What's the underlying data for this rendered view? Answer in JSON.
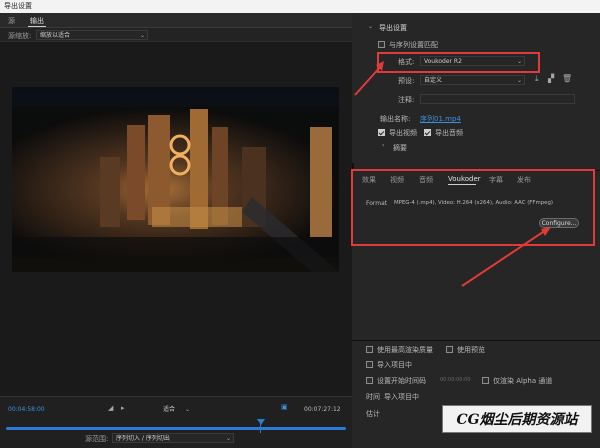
{
  "window": {
    "title": "导出设置"
  },
  "tabs": [
    "源",
    "输出"
  ],
  "scale": {
    "label": "源缩放:",
    "value": "缩放以适合"
  },
  "timeline": {
    "current_time": "00:04:58:00",
    "end_time": "00:07:27:12",
    "zoom_fit": "适合",
    "range_label": "源范围:",
    "range_value": "序列切入 / 序列切出"
  },
  "export_settings": {
    "heading": "导出设置",
    "match_sequence": "与序列设置匹配",
    "format_label": "格式:",
    "format_value": "Voukoder R2",
    "preset_label": "预设:",
    "preset_value": "自定义",
    "comments_label": "注释:",
    "output_label": "输出名称:",
    "output_value": "序列01.mp4",
    "export_video": "导出视频",
    "export_audio": "导出音频",
    "summary": "摘要"
  },
  "subtabs": [
    "效果",
    "视频",
    "音频",
    "Voukoder",
    "字幕",
    "发布"
  ],
  "voukoder": {
    "format_label": "Format",
    "format_value": "MPEG-4 (.mp4), Video: H.264 (x264), Audio: AAC (FFmpeg)",
    "configure_button": "Configure..."
  },
  "bottom": {
    "max_render_quality": "使用最高渲染质量",
    "use_previews": "使用预览",
    "import_project": "导入项目中",
    "set_start_timecode": "设置开始时间码",
    "timecode_value": "00:00:00:00",
    "render_alpha": "仅渲染 Alpha 通道",
    "time_interpolation_label": "时间",
    "time_interpolation_value": "导入项目中",
    "estimate_label": "估计"
  },
  "watermark": {
    "text": "CG烟尘后期资源站"
  },
  "colors": {
    "accent": "#3f8fe0",
    "annotation": "#e03a3a",
    "panel": "#262626"
  }
}
